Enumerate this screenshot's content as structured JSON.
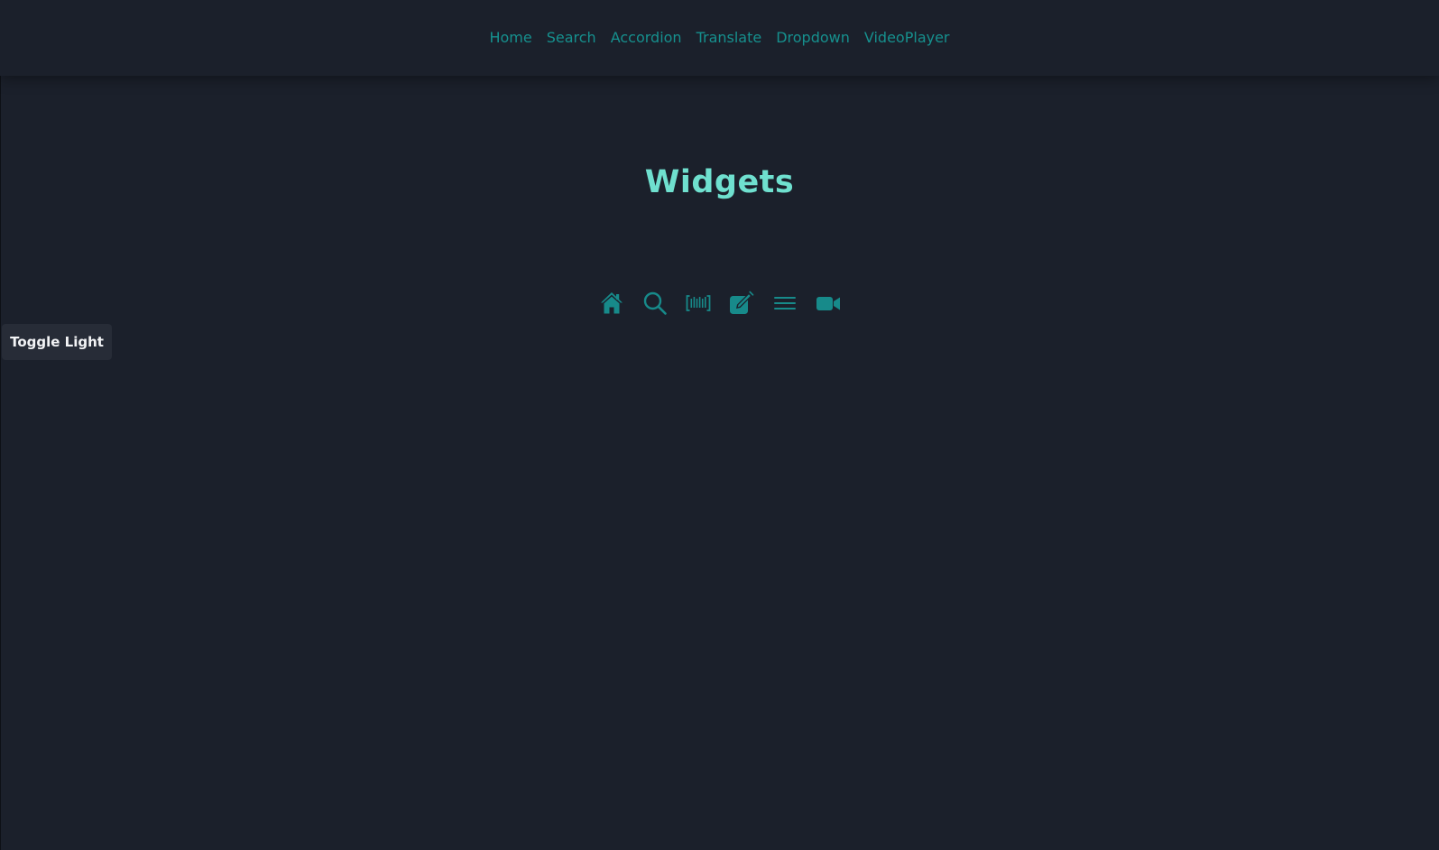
{
  "nav": {
    "links": [
      {
        "label": "Home"
      },
      {
        "label": "Search"
      },
      {
        "label": "Accordion"
      },
      {
        "label": "Translate"
      },
      {
        "label": "Dropdown"
      },
      {
        "label": "VideoPlayer"
      }
    ]
  },
  "main": {
    "title": "Widgets",
    "icons": [
      "home-icon",
      "search-icon",
      "barcode-icon",
      "edit-icon",
      "menu-icon",
      "video-icon"
    ]
  },
  "theme_toggle": {
    "label": "Toggle Light"
  },
  "colors": {
    "background": "#1b202b",
    "nav_link": "#16908e",
    "title": "#6fe0cf",
    "icon": "#178a8a",
    "toggle_bg": "#272c37",
    "toggle_text": "#f3f4f6"
  }
}
